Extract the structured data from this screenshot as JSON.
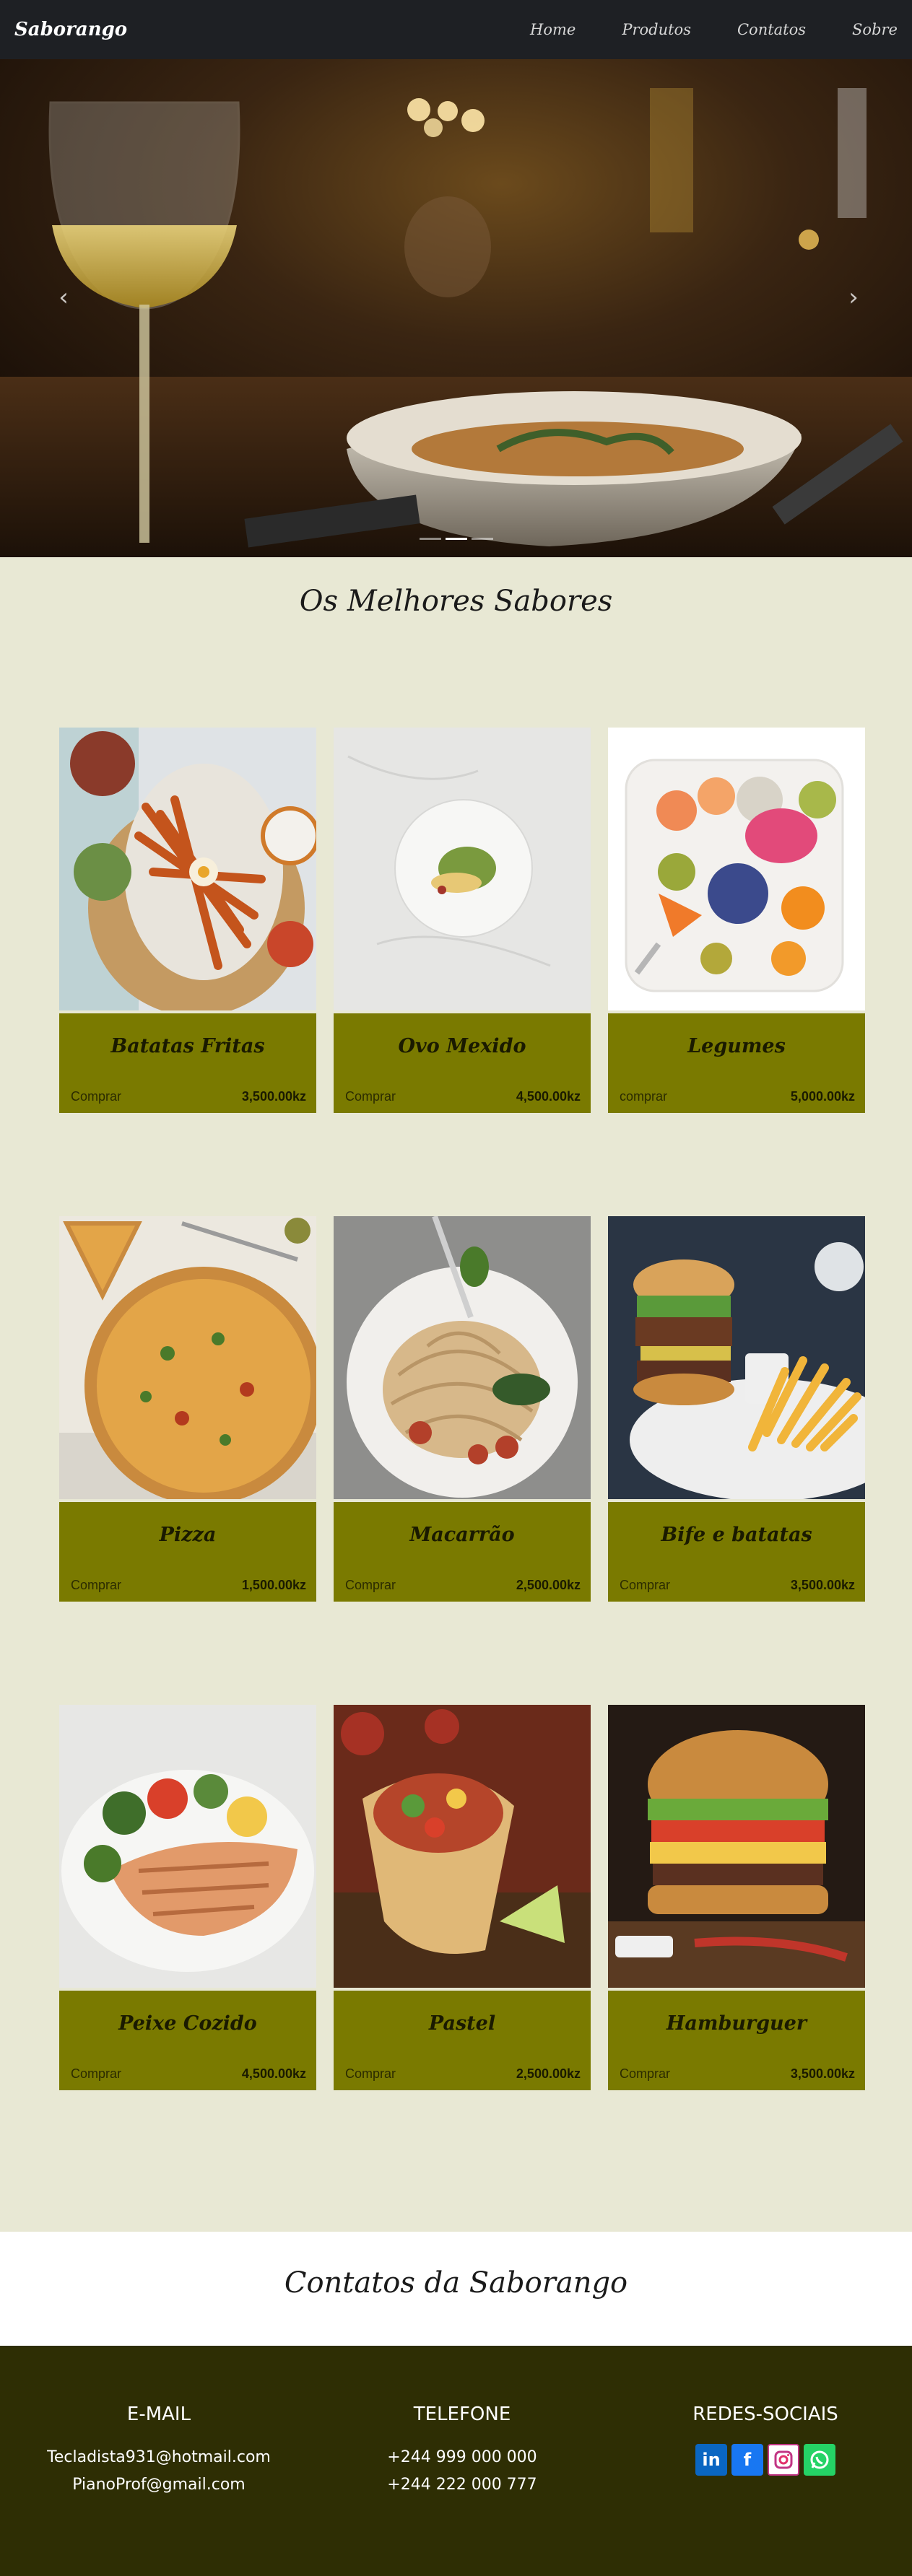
{
  "navbar": {
    "brand": "Saborango",
    "links": [
      "Home",
      "Produtos",
      "Contatos",
      "Sobre"
    ]
  },
  "hero": {
    "prev_icon": "chevron-left-icon",
    "next_icon": "chevron-right-icon",
    "slides": 3,
    "active_slide": 1
  },
  "menu": {
    "title": "Os Melhores Sabores",
    "products": [
      {
        "name": "Batatas Fritas",
        "buy": "Comprar",
        "price": "3,500.00kz"
      },
      {
        "name": "Ovo Mexido",
        "buy": "Comprar",
        "price": "4,500.00kz"
      },
      {
        "name": "Legumes",
        "buy": "comprar",
        "price": "5,000.00kz"
      },
      {
        "name": "Pizza",
        "buy": "Comprar",
        "price": "1,500.00kz"
      },
      {
        "name": "Macarrão",
        "buy": "Comprar",
        "price": "2,500.00kz"
      },
      {
        "name": "Bife e batatas",
        "buy": "Comprar",
        "price": "3,500.00kz"
      },
      {
        "name": "Peixe Cozido",
        "buy": "Comprar",
        "price": "4,500.00kz"
      },
      {
        "name": "Pastel",
        "buy": "Comprar",
        "price": "2,500.00kz"
      },
      {
        "name": "Hamburguer",
        "buy": "Comprar",
        "price": "3,500.00kz"
      }
    ]
  },
  "contacts": {
    "title": "Contatos da Saborango",
    "email": {
      "heading": "E-MAIL",
      "lines": [
        "Tecladista931@hotmail.com",
        "PianoProf@gmail.com"
      ]
    },
    "phone": {
      "heading": "TELEFONE",
      "lines": [
        "+244 999 000 000",
        "+244 222 000 777"
      ]
    },
    "social": {
      "heading": "REDES-SOCIAIS",
      "icons": [
        "linkedin-icon",
        "facebook-icon",
        "instagram-icon",
        "whatsapp-icon"
      ]
    }
  },
  "colors": {
    "navbar": "#1e2024",
    "page_bg": "#e8e8d4",
    "card_band": "#7a7a00",
    "footer": "#2e2e04"
  }
}
